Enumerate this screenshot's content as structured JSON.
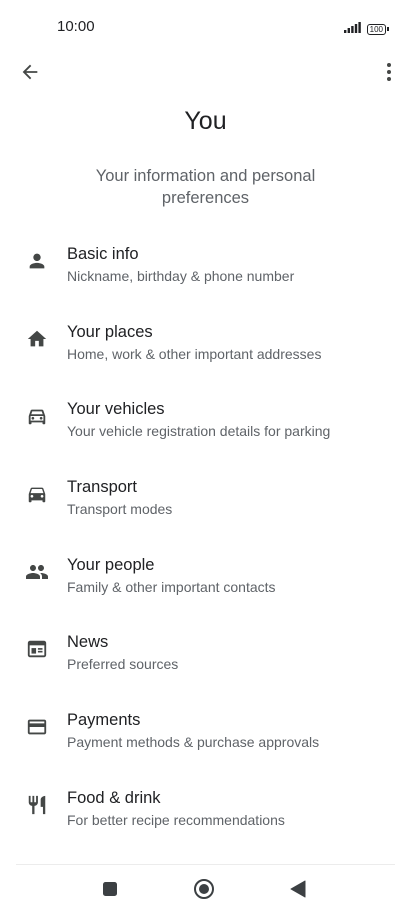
{
  "status_bar": {
    "time": "10:00",
    "battery": "100",
    "icons": [
      "signal-icon",
      "battery-icon"
    ]
  },
  "app_bar": {
    "back_icon": "arrow-back-icon",
    "more_icon": "more-vert-icon"
  },
  "page": {
    "title": "You",
    "subtitle": "Your information and personal preferences"
  },
  "menu": {
    "items": [
      {
        "label": "Basic info",
        "description": "Nickname, birthday & phone number",
        "icon": "person-icon"
      },
      {
        "label": "Your places",
        "description": "Home, work & other important addresses",
        "icon": "home-icon"
      },
      {
        "label": "Your vehicles",
        "description": "Your vehicle registration details for parking",
        "icon": "car-outline-icon"
      },
      {
        "label": "Transport",
        "description": "Transport modes",
        "icon": "car-icon"
      },
      {
        "label": "Your people",
        "description": "Family & other important contacts",
        "icon": "people-icon"
      },
      {
        "label": "News",
        "description": "Preferred sources",
        "icon": "newspaper-icon"
      },
      {
        "label": "Payments",
        "description": "Payment methods & purchase approvals",
        "icon": "credit-card-icon"
      },
      {
        "label": "Food & drink",
        "description": "For better recipe recommendations",
        "icon": "restaurant-icon"
      }
    ]
  },
  "nav_bar": {
    "icons": [
      "recents-square-icon",
      "home-circle-icon",
      "back-triangle-icon"
    ]
  },
  "colors": {
    "primary_text": "#202124",
    "secondary_text": "#5f6368",
    "icon": "#444746",
    "background": "#ffffff"
  }
}
